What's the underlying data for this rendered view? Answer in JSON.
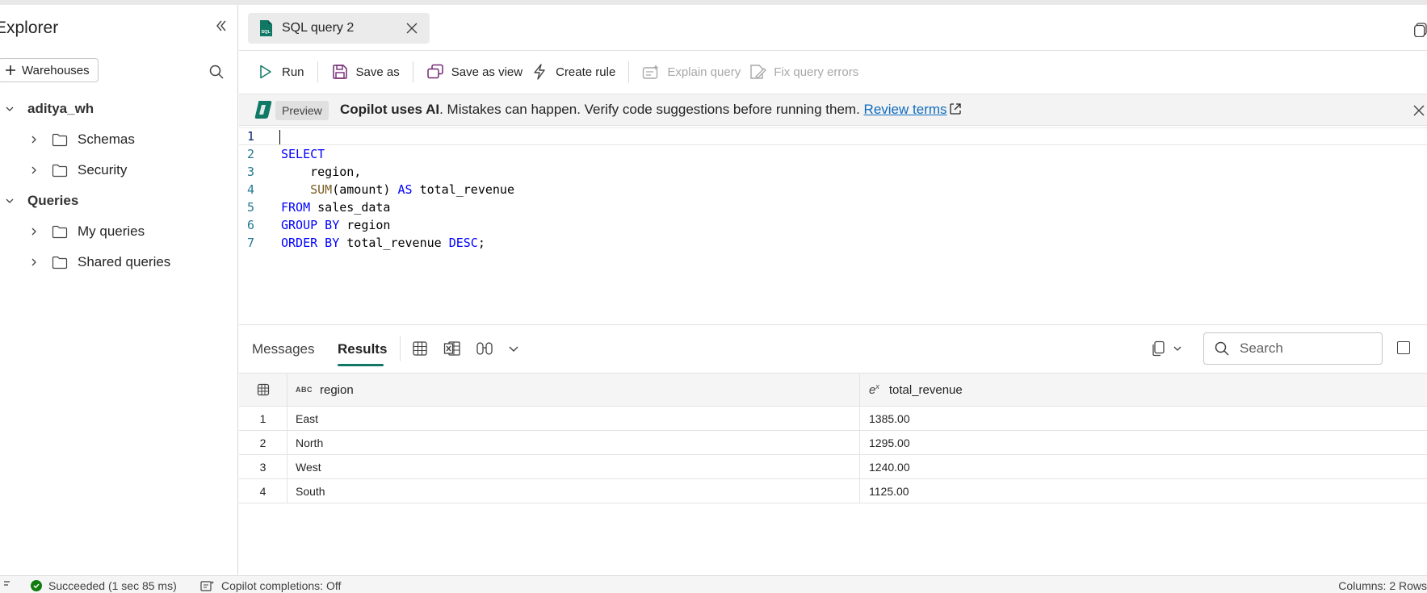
{
  "sidebar": {
    "title": "Explorer",
    "warehouses_button": "Warehouses",
    "tree": [
      {
        "label": "aditya_wh",
        "level": 0,
        "bold": true
      },
      {
        "label": "Schemas",
        "level": 1
      },
      {
        "label": "Security",
        "level": 1
      },
      {
        "label": "Queries",
        "level": 0,
        "bold": true
      },
      {
        "label": "My queries",
        "level": 1
      },
      {
        "label": "Shared queries",
        "level": 1
      }
    ]
  },
  "tab": {
    "label": "SQL query 2"
  },
  "toolbar": {
    "run": "Run",
    "save_as": "Save as",
    "save_as_view": "Save as view",
    "create_rule": "Create rule",
    "explain_query": "Explain query",
    "fix_query_errors": "Fix query errors"
  },
  "copilot": {
    "badge": "Preview",
    "bold_text": "Copilot uses AI",
    "message": ". Mistakes can happen. Verify code suggestions before running them. ",
    "link": "Review terms"
  },
  "editor": {
    "lines": [
      {
        "n": "1",
        "code": ""
      },
      {
        "n": "2",
        "code": "SELECT"
      },
      {
        "n": "3",
        "code": "    region,"
      },
      {
        "n": "4",
        "code": "    SUM(amount) AS total_revenue"
      },
      {
        "n": "5",
        "code": "FROM sales_data"
      },
      {
        "n": "6",
        "code": "GROUP BY region"
      },
      {
        "n": "7",
        "code": "ORDER BY total_revenue DESC;"
      }
    ]
  },
  "results": {
    "tab_messages": "Messages",
    "tab_results": "Results",
    "search_placeholder": "Search",
    "columns": [
      {
        "type_icon": "ABC",
        "name": "region"
      },
      {
        "type_icon": "e^x",
        "name": "total_revenue"
      }
    ],
    "rows": [
      {
        "n": "1",
        "region": "East",
        "total_revenue": "1385.00"
      },
      {
        "n": "2",
        "region": "North",
        "total_revenue": "1295.00"
      },
      {
        "n": "3",
        "region": "West",
        "total_revenue": "1240.00"
      },
      {
        "n": "4",
        "region": "South",
        "total_revenue": "1125.00"
      }
    ]
  },
  "status": {
    "succeeded": "Succeeded (1 sec 85 ms)",
    "copilot": "Copilot completions: Off",
    "summary": "Columns: 2 Rows"
  },
  "colors": {
    "accent": "#117865",
    "link": "#0f6cbd",
    "keyword": "#0000ff",
    "function": "#795e26",
    "success": "#107c10"
  }
}
